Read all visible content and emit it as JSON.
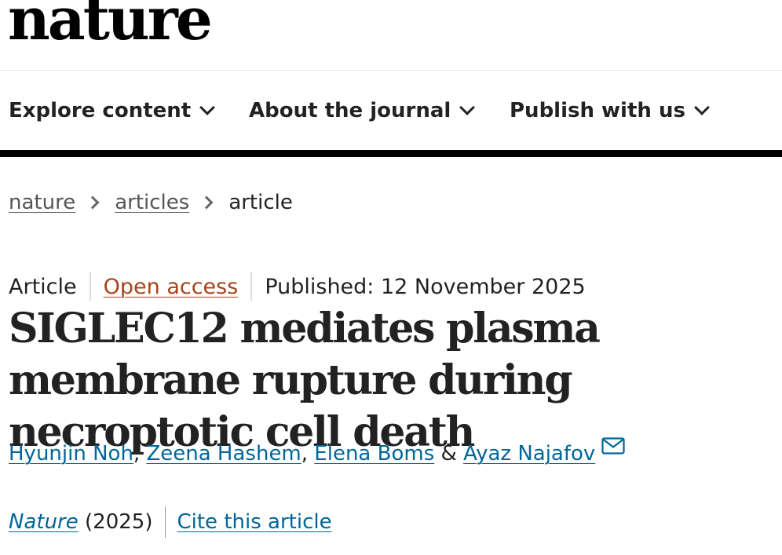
{
  "site": {
    "logo_text": "nature"
  },
  "nav": {
    "items": [
      {
        "label": "Explore content",
        "icon": "chevron-down-icon"
      },
      {
        "label": "About the journal",
        "icon": "chevron-down-icon"
      },
      {
        "label": "Publish with us",
        "icon": "chevron-down-icon"
      }
    ]
  },
  "breadcrumb": {
    "items": [
      "nature",
      "articles",
      "article"
    ]
  },
  "article": {
    "type": "Article",
    "access": "Open access",
    "published": "Published: 12 November 2025",
    "title": "SIGLEC12 mediates plasma membrane rupture during necroptotic cell death",
    "authors": [
      "Hyunjin Noh",
      "Zeena Hashem",
      "Elena Boms",
      "Ayaz Najafov"
    ],
    "author_separator": ",",
    "author_last_separator": "&",
    "journal": "Nature",
    "year": "(2025)",
    "cite_label": "Cite this article"
  },
  "colors": {
    "link": "#006699",
    "open_access": "#a5441a",
    "nav_rule": "#000000"
  }
}
